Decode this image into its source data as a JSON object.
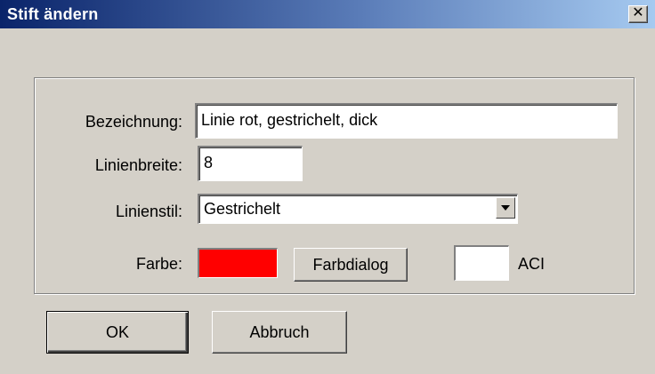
{
  "window": {
    "title": "Stift ändern",
    "close_glyph": "✕"
  },
  "form": {
    "bezeichnung": {
      "label": "Bezeichnung:",
      "value": "Linie rot, gestrichelt, dick"
    },
    "linienbreite": {
      "label": "Linienbreite:",
      "value": "8"
    },
    "linienstil": {
      "label": "Linienstil:",
      "value": "Gestrichelt"
    },
    "farbe": {
      "label": "Farbe:",
      "color": "#ff0000",
      "dialog_button_label": "Farbdialog",
      "aci_color": "#ffffff",
      "aci_label": "ACI"
    }
  },
  "buttons": {
    "ok": "OK",
    "cancel": "Abbruch"
  },
  "icons": {
    "close": "close-icon",
    "dropdown": "chevron-down-icon"
  }
}
